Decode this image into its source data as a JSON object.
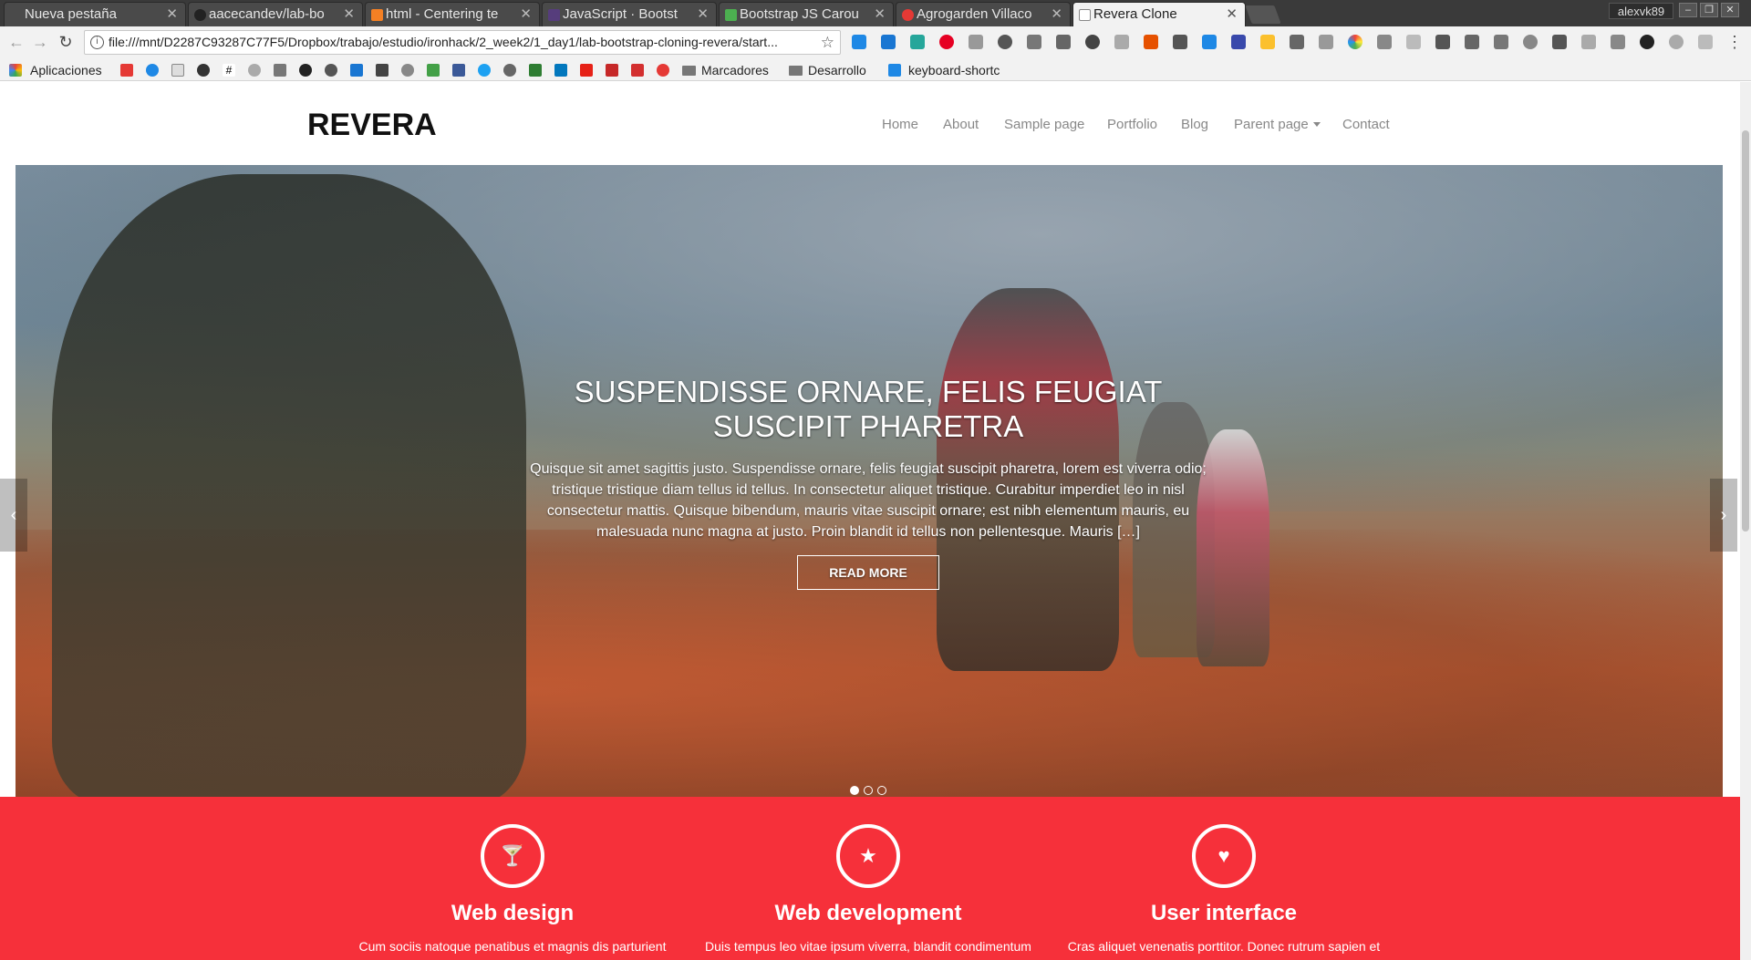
{
  "browser": {
    "tabs": [
      {
        "title": "Nueva pestaña",
        "active": false
      },
      {
        "title": "aacecandev/lab-bo",
        "active": false
      },
      {
        "title": "html - Centering te",
        "active": false
      },
      {
        "title": "JavaScript · Bootst",
        "active": false
      },
      {
        "title": "Bootstrap JS Carou",
        "active": false
      },
      {
        "title": "Agrogarden Villaco",
        "active": false
      },
      {
        "title": "Revera Clone",
        "active": true
      }
    ],
    "profile": "alexvk89",
    "url": "file:///mnt/D2287C93287C77F5/Dropbox/trabajo/estudio/ironhack/2_week2/1_day1/lab-bootstrap-cloning-revera/start...",
    "bookmarks": {
      "apps": "Aplicaciones",
      "folders": [
        "Marcadores",
        "Desarrollo"
      ],
      "last": "keyboard-shortc"
    }
  },
  "site": {
    "brand": "REVERA",
    "nav": [
      "Home",
      "About",
      "Sample page",
      "Portfolio",
      "Blog",
      "Parent page",
      "Contact"
    ],
    "hero": {
      "title": "SUSPENDISSE ORNARE, FELIS FEUGIAT SUSCIPIT PHARETRA",
      "text": "Quisque sit amet sagittis justo. Suspendisse ornare, felis feugiat suscipit pharetra, lorem est viverra odio; tristique tristique diam tellus id tellus. In consectetur aliquet tristique. Curabitur imperdiet leo in nisl consectetur mattis. Quisque bibendum, mauris vitae suscipit ornare; est nibh elementum mauris, eu malesuada nunc magna at justo. Proin blandit id tellus non pellentesque. Mauris […]",
      "button": "READ MORE",
      "slides": 3,
      "active_slide": 1
    },
    "features": [
      {
        "icon": "cocktail-icon",
        "glyph": "🍸",
        "title": "Web design",
        "text": "Cum sociis natoque penatibus et magnis dis parturient"
      },
      {
        "icon": "star-icon",
        "glyph": "★",
        "title": "Web development",
        "text": "Duis tempus leo vitae ipsum viverra, blandit condimentum"
      },
      {
        "icon": "heart-icon",
        "glyph": "♥",
        "title": "User interface",
        "text": "Cras aliquet venenatis porttitor. Donec rutrum sapien et"
      }
    ],
    "colors": {
      "accent": "#f6303a"
    }
  }
}
